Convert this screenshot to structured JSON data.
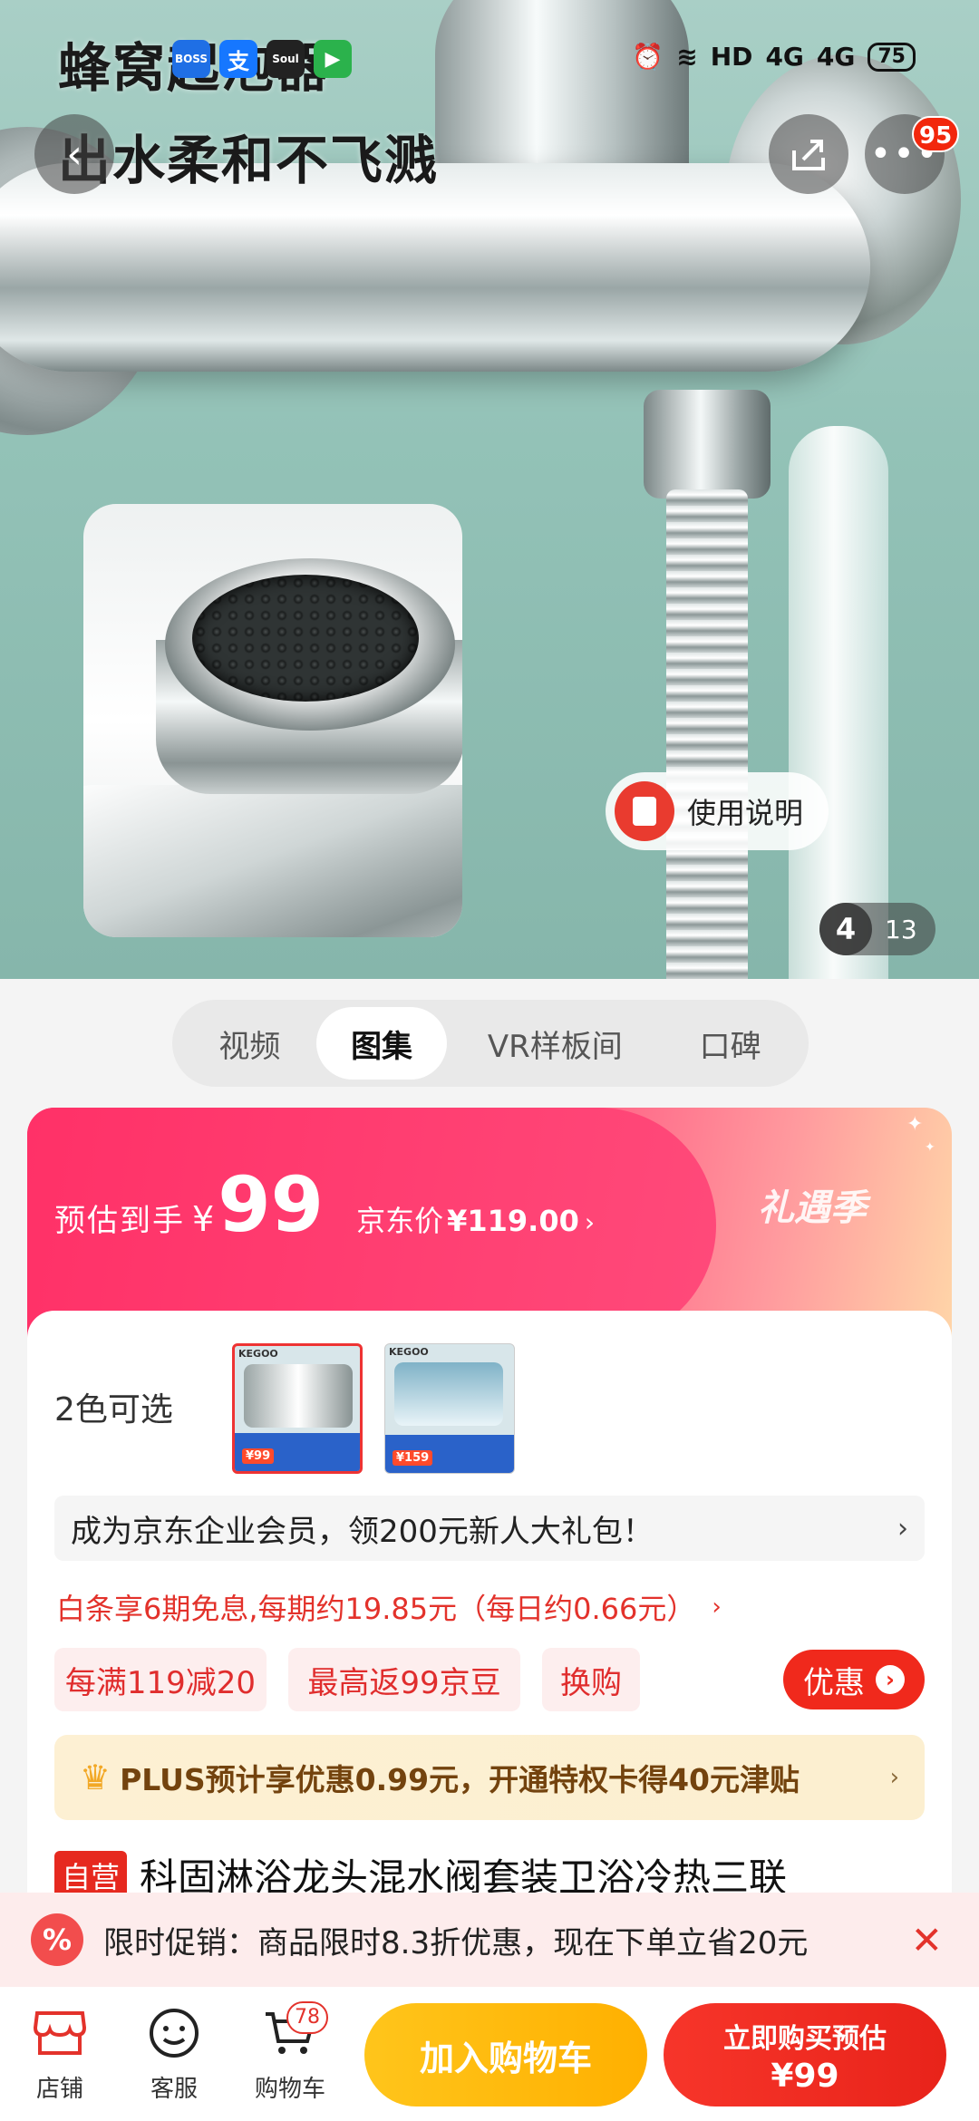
{
  "status_bar": {
    "battery": "75",
    "network": "HD",
    "signal1": "4G",
    "signal2": "4G",
    "apps": [
      "BOSS直聘",
      "支付宝",
      "Soul",
      "视频"
    ]
  },
  "hero": {
    "headline_1": "蜂窝起泡器",
    "headline_2": "出水柔和不飞溅",
    "more_badge": "95",
    "manual_label": "使用说明",
    "counter_current": "4",
    "counter_total": "13"
  },
  "media_tabs": [
    "视频",
    "图集",
    "VR样板间",
    "口碑"
  ],
  "media_tab_selected": "图集",
  "price": {
    "label": "预估到手",
    "currency": "¥",
    "amount": "99",
    "jd_label": "京东价",
    "jd_price": "¥119.00",
    "arrow": "›",
    "brand": "礼遇季"
  },
  "variants": {
    "label": "2色可选",
    "brand_tag": "KEGOO",
    "thumb_a_price": "¥99",
    "thumb_b_price": "¥159"
  },
  "member_bar": {
    "text": "成为京东企业会员，领200元新人大礼包！",
    "chevron": "›"
  },
  "baitiao": {
    "text": "白条享6期免息,每期约19.85元（每日约0.66元）",
    "chevron": "›"
  },
  "promos": [
    "每满119减20",
    "最高返99京豆",
    "换购"
  ],
  "discount_button": "优惠",
  "plus_bar": {
    "text": "PLUS预计享优惠0.99元，开通特权卡得40元津贴",
    "chevron": "›"
  },
  "product": {
    "tag": "自营",
    "title": "科固淋浴龙头混水阀套装卫浴冷热三联"
  },
  "flash_sale": {
    "icon": "%",
    "text": "限时促销：商品限时8.3折优惠，现在下单立省20元",
    "close": "✕"
  },
  "bottom_bar": {
    "store": "店铺",
    "service": "客服",
    "cart": "购物车",
    "cart_badge": "78",
    "add_to_cart": "加入购物车",
    "buy_now_line1": "立即购买预估",
    "buy_now_line2": "¥99"
  },
  "colors": {
    "brand_red": "#f0291c",
    "cart_yellow": "#ffb000",
    "banner_pink": "#ff3b6e"
  }
}
